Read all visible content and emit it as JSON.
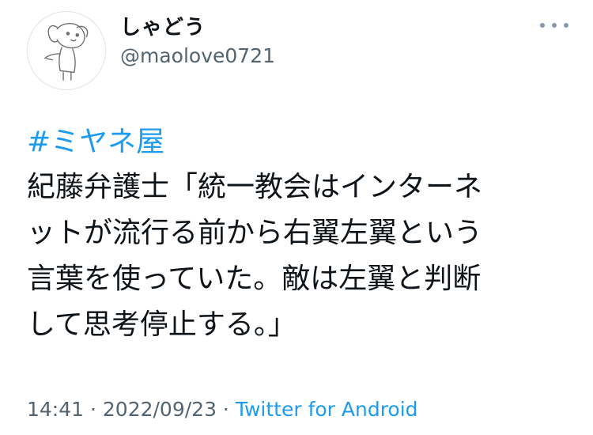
{
  "user": {
    "display_name": "しゃどう",
    "handle": "@maolove0721"
  },
  "tweet": {
    "hashtag": "#ミヤネ屋",
    "lines": [
      "紀藤弁護士「統一教会はインターネ",
      "ットが流行る前から右翼左翼という",
      "言葉を使っていた。敵は左翼と判断",
      "して思考停止する。」"
    ]
  },
  "meta": {
    "time": "14:41",
    "separator1": " · ",
    "date": "2022/09/23",
    "separator2": " · ",
    "source": "Twitter for Android"
  },
  "colors": {
    "link": "#1d9bf0",
    "text": "#0f1419",
    "secondary": "#536471"
  },
  "icons": {
    "more": "more-icon",
    "avatar": "dog-sketch-avatar"
  }
}
